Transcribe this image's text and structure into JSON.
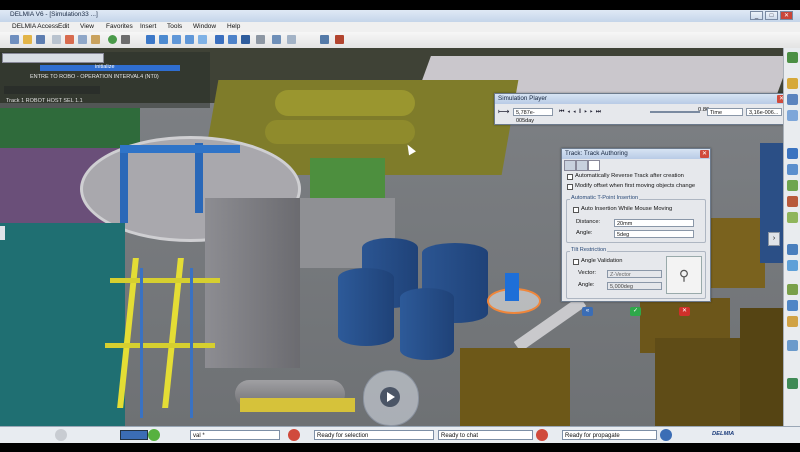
{
  "window": {
    "title": "DELMIA V6 - [Simulation33 ...]",
    "minimize": "_",
    "maximize": "□",
    "close": "✕"
  },
  "menu": [
    "DELMIA Access",
    "Edit",
    "View",
    "Favorites",
    "Insert",
    "Tools",
    "Window",
    "Help"
  ],
  "tree": {
    "progress_label": "initialize",
    "item1": "ENTRE TO ROBO - OPERATION INTERVAL4 (NT0)",
    "item2": "Track 1  ROBOT HOST SEL 1.1"
  },
  "sim_player": {
    "title": "Simulation Player",
    "time_value": "5,787e-005day",
    "speed_value": "0.86",
    "mode": "Time",
    "step_value": "3,16e-006..."
  },
  "track": {
    "title": "Track: Track Authoring",
    "cb_reverse": "Automatically Reverse Track after creation",
    "cb_modify": "Modify offset when first moving objects change",
    "group_auto": "Automatic T-Point Insertion",
    "cb_auto_insert": "Auto Insertion While Mouse Moving",
    "distance_label": "Distance:",
    "distance_value": "20mm",
    "angle_label": "Angle:",
    "angle_value": "5deg",
    "group_tilt": "Tilt Restriction",
    "cb_angle_validation": "Angle Validation",
    "vector_label": "Vector:",
    "vector_value": "Z-Vector",
    "tilt_angle_label": "Angle:",
    "tilt_angle_value": "5,000deg"
  },
  "status": {
    "cmd_value": "val *",
    "field1": "Ready for selection",
    "field2": "Ready to chat",
    "field3": "Ready for propagate",
    "brand": "DELMIA"
  },
  "colors": {
    "accent": "#3b6db5",
    "ok": "#2fa84a",
    "cancel": "#d0302a"
  }
}
